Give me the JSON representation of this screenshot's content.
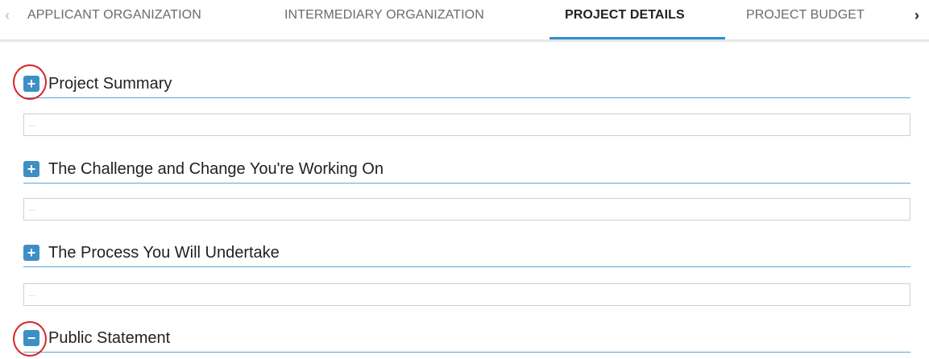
{
  "tabs": {
    "prev_arrow": "‹",
    "next_arrow": "›",
    "items": [
      {
        "label": "APPLICANT ORGANIZATION"
      },
      {
        "label": "INTERMEDIARY ORGANIZATION"
      },
      {
        "label": "PROJECT DETAILS",
        "active": true
      },
      {
        "label": "PROJECT BUDGET"
      }
    ]
  },
  "sections": [
    {
      "title": "Project Summary",
      "toggle": "+",
      "state": "collapsed",
      "field_value": "..."
    },
    {
      "title": "The Challenge and Change You're Working On",
      "toggle": "+",
      "state": "collapsed",
      "field_value": "..."
    },
    {
      "title": "The Process You Will Undertake",
      "toggle": "+",
      "state": "collapsed",
      "field_value": "..."
    },
    {
      "title": "Public Statement",
      "toggle": "−",
      "state": "expanded"
    }
  ],
  "colors": {
    "accent": "#2f8fd0",
    "icon_bg": "#3d8fc4",
    "annotation_circle": "#d8232a"
  }
}
